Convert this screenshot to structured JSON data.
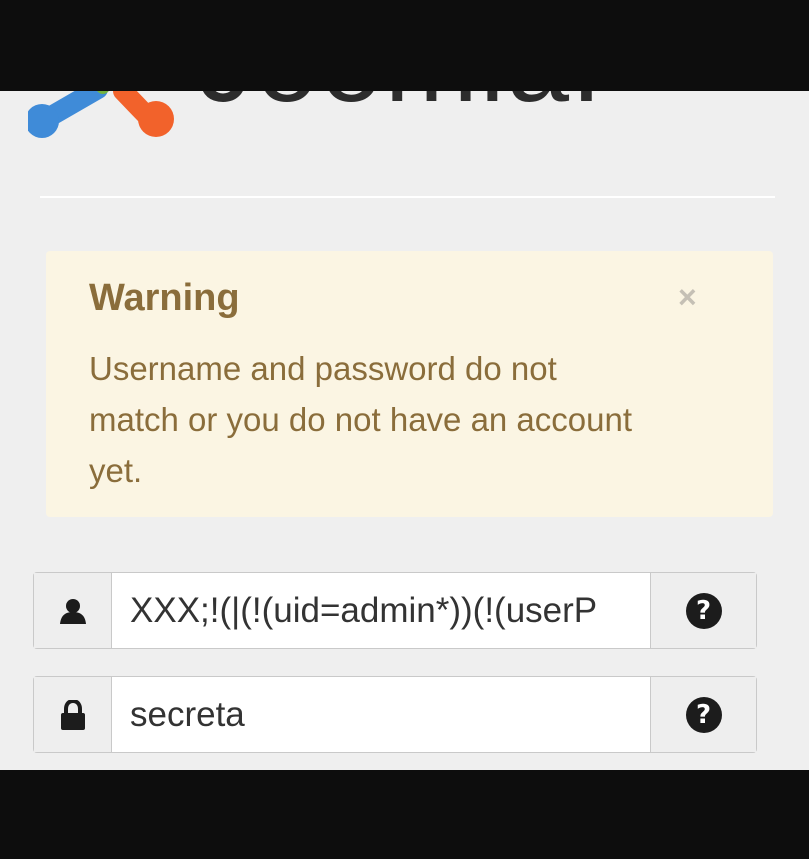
{
  "brand": {
    "wordmark": "Joomla!",
    "colors": {
      "blue": "#3f8bd8",
      "orange": "#f2622b",
      "green": "#74b33f",
      "text": "#2c2c2c"
    }
  },
  "alert": {
    "heading": "Warning",
    "message": "Username and password do not match or you do not have an account yet.",
    "close_label": "×",
    "colors": {
      "background": "#fbf5e3",
      "text": "#8a6d3b"
    }
  },
  "username": {
    "icon": "user-icon",
    "value": "XXX;!(|(!(uid=admin*))(!(userP",
    "help_icon": "question-icon",
    "help_label": "?"
  },
  "password": {
    "icon": "lock-icon",
    "value": "secreta",
    "help_icon": "question-icon",
    "help_label": "?"
  }
}
